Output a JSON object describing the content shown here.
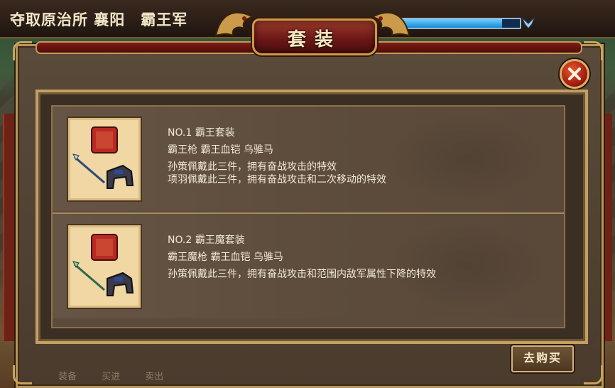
{
  "topbar": {
    "title": "夺取原治所 襄阳　霸王军"
  },
  "banner": {
    "title": "套装"
  },
  "sets": [
    {
      "header": "NO.1 霸王套装",
      "items": "霸王枪 霸王血铠 乌骓马",
      "effects": [
        "孙策佩戴此三件，拥有奋战攻击的特效",
        "项羽佩戴此三件，拥有奋战攻击和二次移动的特效"
      ]
    },
    {
      "header": "NO.2 霸王魔套装",
      "items": "霸王魔枪 霸王血铠 乌骓马",
      "effects": [
        "孙策佩戴此三件，拥有奋战攻击和范围内敌军属性下降的特效"
      ]
    }
  ],
  "buy_button": {
    "label": "去购买"
  },
  "bottom_buttons": [
    "装备",
    "买进",
    "卖出"
  ],
  "icons": {
    "close": "close-icon",
    "bird": "bird-icon",
    "dragon": "dragon-ornament"
  },
  "colors": {
    "dialog_border": "#c2a062",
    "banner_red": "#6a1616",
    "text": "#f2ead4",
    "hp_fill": "#1489d6"
  },
  "status": {
    "hp_level": 0.85
  }
}
